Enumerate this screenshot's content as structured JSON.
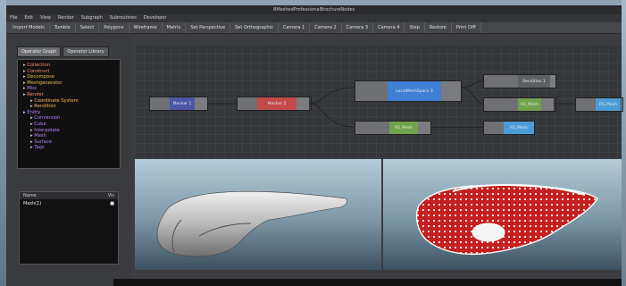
{
  "window": {
    "title": "BMeshedProfessionalBrochureNodes"
  },
  "menubar": [
    "File",
    "Edit",
    "View",
    "Render",
    "Subgraph",
    "Subroutines",
    "Developer"
  ],
  "toolbar": [
    "Import Models",
    "Tumble",
    "Select",
    "Polygons",
    "Wireframe",
    "Matrix",
    "Set Perspective",
    "Set Orthographic",
    "Camera 1",
    "Camera 2",
    "Camera 3",
    "Camera 4",
    "Step",
    "Restore",
    "Print Diff"
  ],
  "left_panel": {
    "tabs": [
      "Operator Graph",
      "Operator Library"
    ],
    "tree": [
      {
        "label": "Collection",
        "color": "#ff8e6a",
        "indent": 0
      },
      {
        "label": "Construct",
        "color": "#ff8e6a",
        "indent": 0
      },
      {
        "label": "Decompose",
        "color": "#e2c04e",
        "indent": 0
      },
      {
        "label": "Meshgenerator",
        "color": "#e2c04e",
        "indent": 0
      },
      {
        "label": "Misc",
        "color": "#b980ff",
        "indent": 0
      },
      {
        "label": "Render",
        "color": "#ff8e6a",
        "indent": 0
      },
      {
        "label": "Coordinate System",
        "color": "#ffb85a",
        "indent": 1
      },
      {
        "label": "Rendition",
        "color": "#ffb85a",
        "indent": 1
      },
      {
        "label": "Entity",
        "color": "#b980ff",
        "indent": 0
      },
      {
        "label": "Conversion",
        "color": "#b980ff",
        "indent": 1
      },
      {
        "label": "Cube",
        "color": "#b980ff",
        "indent": 1
      },
      {
        "label": "Interpolate",
        "color": "#b980ff",
        "indent": 1
      },
      {
        "label": "Mesh",
        "color": "#b980ff",
        "indent": 1
      },
      {
        "label": "Surface",
        "color": "#b980ff",
        "indent": 1
      },
      {
        "label": "Tags",
        "color": "#b980ff",
        "indent": 1
      }
    ]
  },
  "layers": {
    "columns": [
      "Name",
      "Vis"
    ],
    "rows": [
      {
        "name": "Mesh(1)",
        "vis": "■"
      }
    ]
  },
  "nodes": [
    {
      "label": "Mesher 1",
      "color": "#4c56a6"
    },
    {
      "label": "Mesher 2",
      "color": "#c34a4a"
    },
    {
      "label": "LocalMeshSpace 3",
      "color": "#3f7fd6"
    },
    {
      "label": "Rendition 1",
      "color": "#5c5f63"
    },
    {
      "label": "RS_Mesh",
      "color": "#6ea24c"
    },
    {
      "label": "RS_Mesh",
      "color": "#4a9bd6"
    },
    {
      "label": "RS_Mesh",
      "color": "#6ea24c"
    },
    {
      "label": "RS_Mesh",
      "color": "#4a9bd6"
    }
  ]
}
